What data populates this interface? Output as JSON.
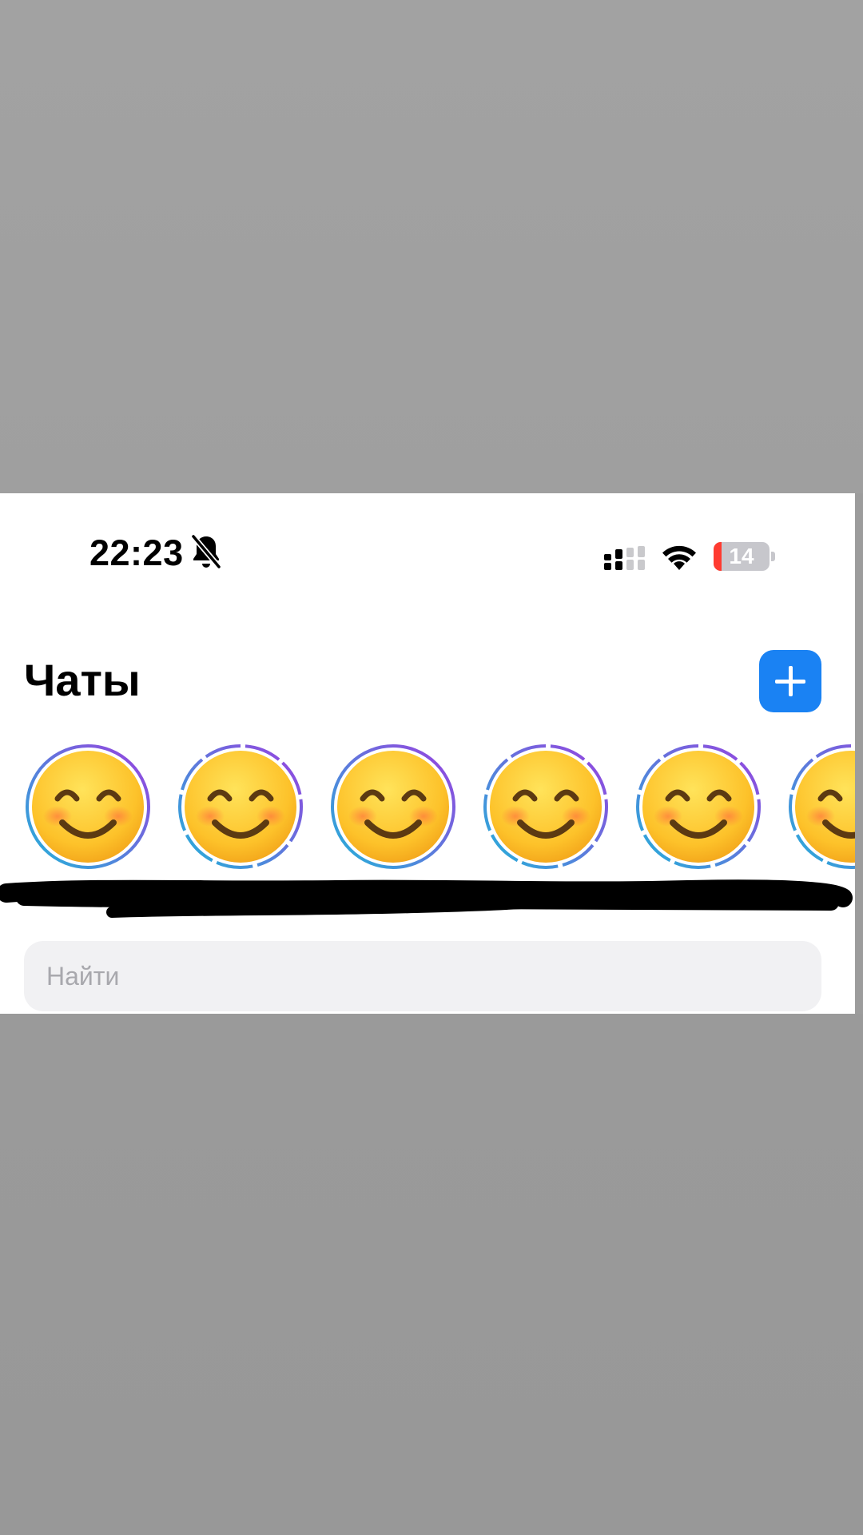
{
  "status_bar": {
    "time": "22:23",
    "muted": true,
    "battery_level": "14",
    "battery_fraction": 0.14,
    "icons": [
      "bell-slash-icon",
      "cellular-signal-icon",
      "wifi-icon",
      "battery-icon"
    ]
  },
  "header": {
    "title": "Чаты",
    "new_chat_icon": "plus-icon"
  },
  "stories": {
    "items": [
      {
        "avatar": "smiling-face-emoji",
        "ring": "segmented-gradient"
      },
      {
        "avatar": "smiling-face-emoji",
        "ring": "segmented-gradient"
      },
      {
        "avatar": "smiling-face-emoji",
        "ring": "segmented-gradient"
      },
      {
        "avatar": "smiling-face-emoji",
        "ring": "segmented-gradient"
      },
      {
        "avatar": "smiling-face-emoji",
        "ring": "segmented-gradient"
      },
      {
        "avatar": "smiling-face-emoji",
        "ring": "segmented-gradient"
      }
    ],
    "redacted_names": true
  },
  "search": {
    "placeholder": "Найти",
    "value": ""
  },
  "colors": {
    "accent": "#1a82f3",
    "ring_start": "#22b3d9",
    "ring_end": "#9b3fe0",
    "search_bg": "#f1f1f3",
    "backdrop": "#9c9c9c"
  }
}
